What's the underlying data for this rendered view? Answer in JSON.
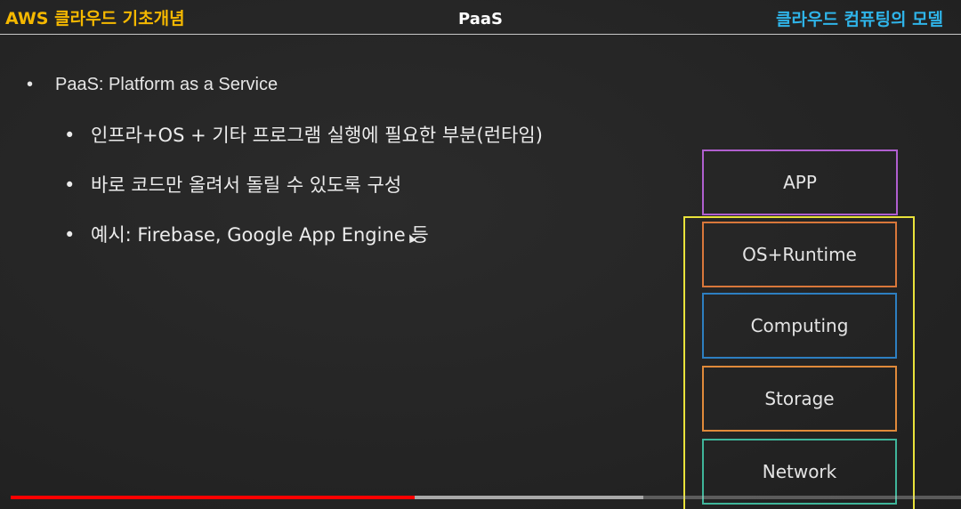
{
  "header": {
    "left_title": "AWS 클라우드 기초개념",
    "center_title": "PaaS",
    "right_title": "클라우드 컴퓨팅의 모델",
    "left_color": "#f5b800",
    "right_color": "#2fb4e9"
  },
  "content": {
    "main_bullet": "PaaS: Platform as a Service",
    "sub_bullets": [
      "인프라+OS + 기타 프로그램 실행에 필요한 부분(런타임)",
      "바로 코드만 올려서 돌릴 수 있도록 구성",
      "예시: Firebase, Google App Engine 등"
    ],
    "bullet_glyph": "•"
  },
  "stack": {
    "layers": [
      {
        "label": "APP",
        "color": "#b05fcf"
      },
      {
        "label": "OS+Runtime",
        "color": "#d9773a"
      },
      {
        "label": "Computing",
        "color": "#2d7fc1"
      },
      {
        "label": "Storage",
        "color": "#e08a3a"
      },
      {
        "label": "Network",
        "color": "#3fb59a"
      }
    ],
    "paas_frame_color": "#e9e23a"
  },
  "player": {
    "played_fraction": 0.425,
    "buffered_fraction": 0.666,
    "played_color": "#ff0000"
  },
  "icons": {
    "cursor": "mouse-pointer-icon"
  }
}
